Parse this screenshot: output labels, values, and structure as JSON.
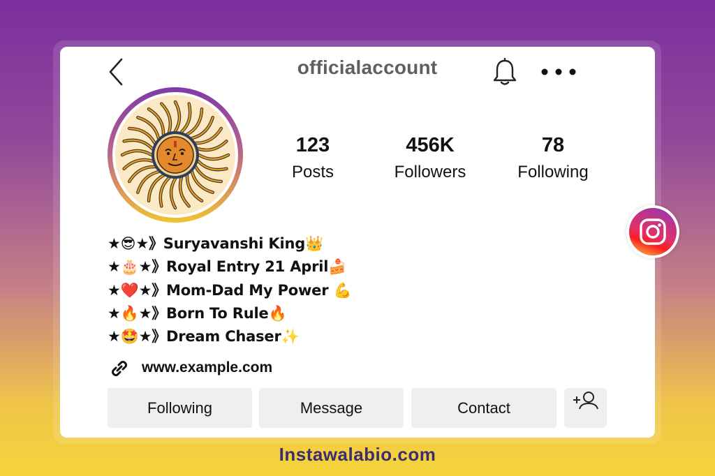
{
  "header": {
    "username": "officialaccount"
  },
  "stats": [
    {
      "value": "123",
      "label": "Posts"
    },
    {
      "value": "456K",
      "label": "Followers"
    },
    {
      "value": "78",
      "label": "Following"
    }
  ],
  "bio": {
    "lines": [
      "★😎★》Suryavanshi King👑",
      "★🎂★》Royal Entry 21 April🍰",
      "★❤️★》Mom-Dad My Power 💪",
      "★🔥★》Born To Rule🔥",
      "★🤩★》Dream Chaser✨"
    ],
    "link": "www.example.com"
  },
  "actions": {
    "following_label": "Following",
    "message_label": "Message",
    "contact_label": "Contact"
  },
  "footer": {
    "brand": "Instawalabio.com"
  },
  "icons": {
    "back": "chevron-left-icon",
    "bell": "bell-icon",
    "more": "more-dots-icon",
    "link": "link-icon",
    "add_user": "add-user-icon",
    "instagram": "instagram-logo-icon"
  },
  "colors": {
    "background_top": "#7b2f9e",
    "background_bottom": "#f5d53a",
    "username": "#5f5f5f",
    "button_bg": "#efefef",
    "footer_text": "#3c2d6e"
  }
}
